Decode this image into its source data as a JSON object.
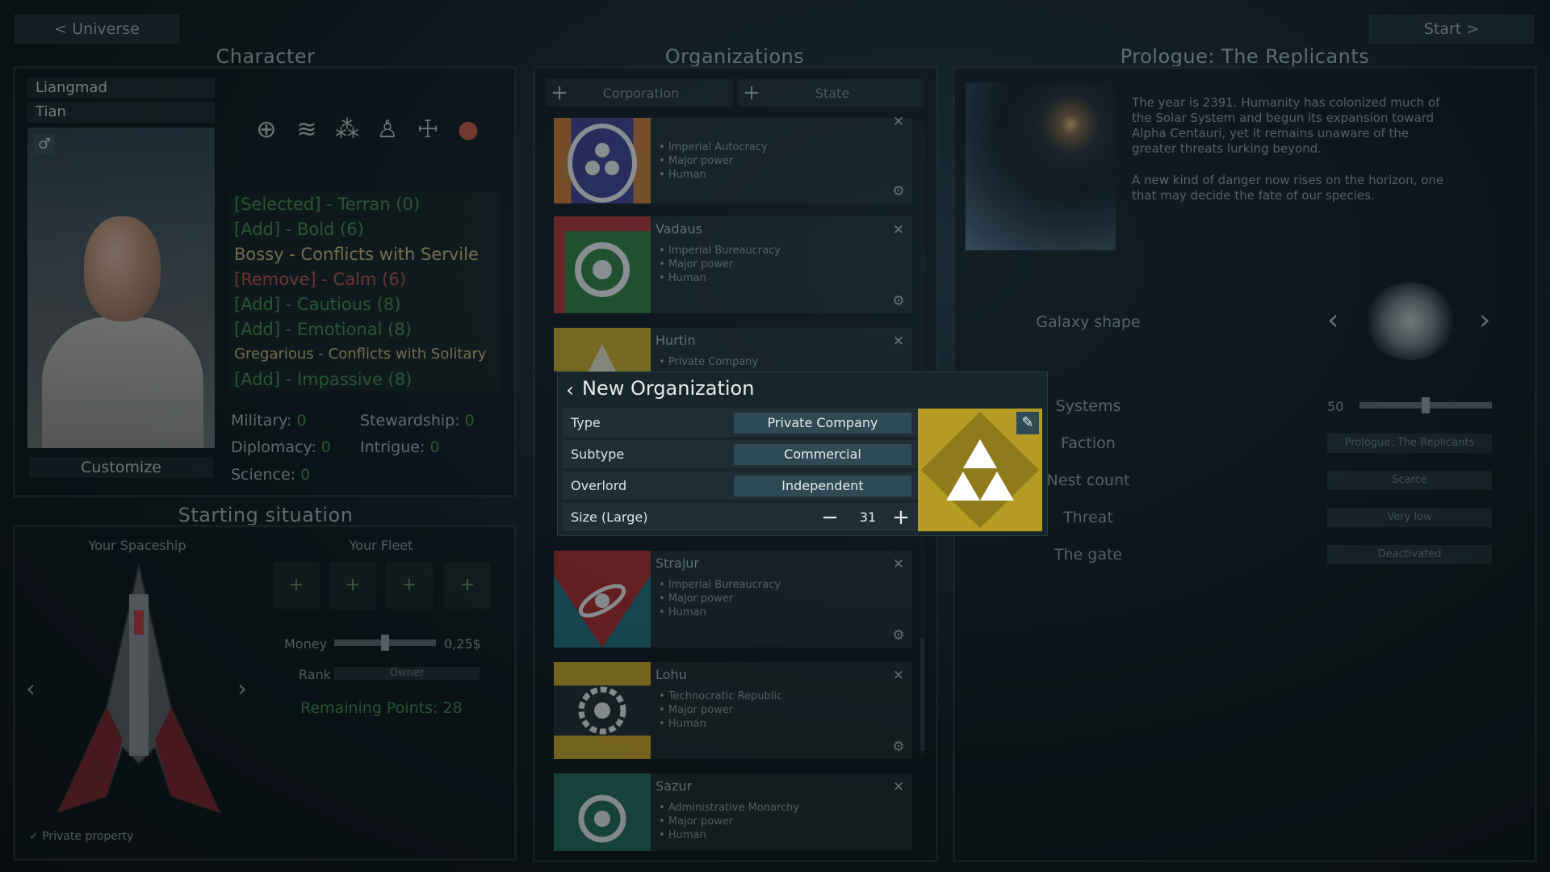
{
  "nav": {
    "back_label": "< Universe",
    "start_label": "Start >"
  },
  "character": {
    "title": "Character",
    "first_name": "Liangmad",
    "last_name": "Tian",
    "gender_icon": "♂",
    "customize_label": "Customize",
    "trait_icons": [
      "crosshair-icon",
      "waves-icon",
      "crowd-icon",
      "people-icon",
      "totem-icon",
      "alien-icon"
    ],
    "traits": [
      {
        "text": "[Selected] - Terran (0)",
        "color": "green"
      },
      {
        "text": "[Add] - Bold (6)",
        "color": "green"
      },
      {
        "text": "Bossy - Conflicts with Servile",
        "color": "yellow"
      },
      {
        "text": "[Remove] - Calm (6)",
        "color": "red"
      },
      {
        "text": "[Add] - Cautious (8)",
        "color": "green"
      },
      {
        "text": "[Add] - Emotional (8)",
        "color": "green"
      },
      {
        "text": "Gregarious - Conflicts with Solitary",
        "color": "yellow"
      },
      {
        "text": "[Add] - Impassive (8)",
        "color": "green"
      }
    ],
    "stats": {
      "military_label": "Military:",
      "military": "0",
      "stewardship_label": "Stewardship:",
      "stewardship": "0",
      "diplomacy_label": "Diplomacy:",
      "diplomacy": "0",
      "intrigue_label": "Intrigue:",
      "intrigue": "0",
      "science_label": "Science:",
      "science": "0"
    }
  },
  "starting": {
    "title": "Starting situation",
    "spaceship_label": "Your Spaceship",
    "fleet_label": "Your Fleet",
    "fleet_slots": [
      "+",
      "+",
      "+",
      "+"
    ],
    "money_label": "Money",
    "money_value": "0,25$",
    "money_fraction": 0.5,
    "rank_label": "Rank",
    "rank_value": "Owner",
    "remaining_points": "Remaining Points: 28",
    "private_property_label": "Private property",
    "private_property_checked": true
  },
  "organizations": {
    "title": "Organizations",
    "tabs": [
      {
        "label": "Corporation"
      },
      {
        "label": "State"
      }
    ],
    "cards": [
      {
        "name": "",
        "info": [
          "Imperial Autocracy",
          "Major power",
          "Human"
        ],
        "flag": "purple"
      },
      {
        "name": "Vadaus",
        "info": [
          "Imperial Bureaucracy",
          "Major power",
          "Human"
        ],
        "flag": "green"
      },
      {
        "name": "Hurtin",
        "info": [
          "Private Company"
        ],
        "flag": "yellow"
      },
      {
        "name": "Strajur",
        "info": [
          "Imperial Bureaucracy",
          "Major power",
          "Human"
        ],
        "flag": "red"
      },
      {
        "name": "Lohu",
        "info": [
          "Technocratic Republic",
          "Major power",
          "Human"
        ],
        "flag": "gold"
      },
      {
        "name": "Sazur",
        "info": [
          "Administrative Monarchy",
          "Major power",
          "Human"
        ],
        "flag": "teal"
      }
    ]
  },
  "modal": {
    "title": "New Organization",
    "type_label": "Type",
    "type_value": "Private Company",
    "subtype_label": "Subtype",
    "subtype_value": "Commercial",
    "overlord_label": "Overlord",
    "overlord_value": "Independent",
    "size_label": "Size (Large)",
    "size_value": "31",
    "logo_color": "#b59a24"
  },
  "prologue": {
    "title": "Prologue: The Replicants",
    "paragraphs": [
      "The year is 2391. Humanity has colonized much of the Solar System and begun its expansion toward Alpha Centauri, yet it remains unaware of the greater threats lurking beyond.",
      "A new kind of danger now rises on the horizon, one that may decide the fate of our species."
    ],
    "galaxy_label": "Galaxy shape",
    "systems_label": "Systems",
    "systems_value": "50",
    "systems_fraction": 0.5,
    "faction_label": "Faction",
    "faction_value": "Prologue: The Replicants",
    "nest_label": "Nest count",
    "nest_value": "Scarce",
    "threat_label": "Threat",
    "threat_value": "Very low",
    "gate_label": "The gate",
    "gate_value": "Deactivated"
  }
}
